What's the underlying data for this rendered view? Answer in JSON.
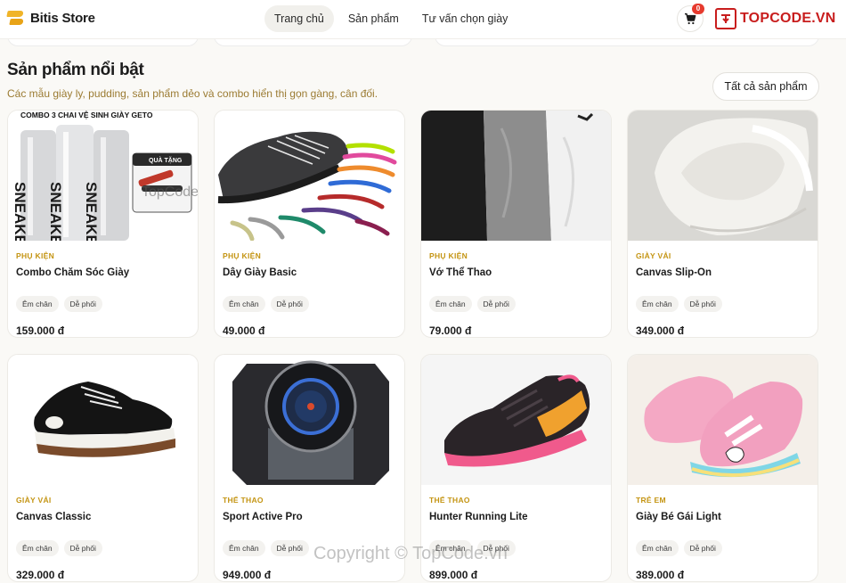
{
  "header": {
    "logo_text": "Bitis Store",
    "nav": [
      "Trang chủ",
      "Sản phẩm",
      "Tư vấn chọn giày"
    ],
    "cart_count": "0",
    "brand_tag": "TOPCODE.VN"
  },
  "section": {
    "title": "Sản phẩm nổi bật",
    "subtitle": "Các mẫu giày ly, pudding, sản phẩm dẻo và combo hiển thị gọn gàng, cân đối.",
    "all_button": "Tất cả sản phẩm"
  },
  "products": [
    {
      "category": "PHỤ KIỆN",
      "name": "Combo Chăm Sóc Giày",
      "tags": [
        "Êm chân",
        "Dễ phối"
      ],
      "price": "159.000 đ",
      "image_caption": "COMBO 3 CHAI VỆ SINH GIÀY GETO",
      "image_badge": "QUÀ TẶNG",
      "image_overlay": "TopCode.vn"
    },
    {
      "category": "PHỤ KIỆN",
      "name": "Dây Giày Basic",
      "tags": [
        "Êm chân",
        "Dễ phối"
      ],
      "price": "49.000 đ"
    },
    {
      "category": "PHỤ KIỆN",
      "name": "Vớ Thể Thao",
      "tags": [
        "Êm chân",
        "Dễ phối"
      ],
      "price": "79.000 đ"
    },
    {
      "category": "GIÀY VẢI",
      "name": "Canvas Slip-On",
      "tags": [
        "Êm chân",
        "Dễ phối"
      ],
      "price": "349.000 đ"
    },
    {
      "category": "GIÀY VẢI",
      "name": "Canvas Classic",
      "tags": [
        "Êm chân",
        "Dễ phối"
      ],
      "price": "329.000 đ"
    },
    {
      "category": "THỂ THAO",
      "name": "Sport Active Pro",
      "tags": [
        "Êm chân",
        "Dễ phối"
      ],
      "price": "949.000 đ"
    },
    {
      "category": "THỂ THAO",
      "name": "Hunter Running Lite",
      "tags": [
        "Êm chân",
        "Dễ phối"
      ],
      "price": "899.000 đ"
    },
    {
      "category": "TRẺ EM",
      "name": "Giày Bé Gái Light",
      "tags": [
        "Êm chân",
        "Dễ phối"
      ],
      "price": "389.000 đ"
    }
  ],
  "watermark": "Copyright © TopCode.vn",
  "colors": {
    "accent": "#c49412",
    "subtitle": "#9b7b32",
    "badge": "#e63a2e",
    "brand": "#c81d1d"
  },
  "icons": [
    "shoe-logo-icon",
    "cart-icon",
    "brand-logo-icon"
  ]
}
